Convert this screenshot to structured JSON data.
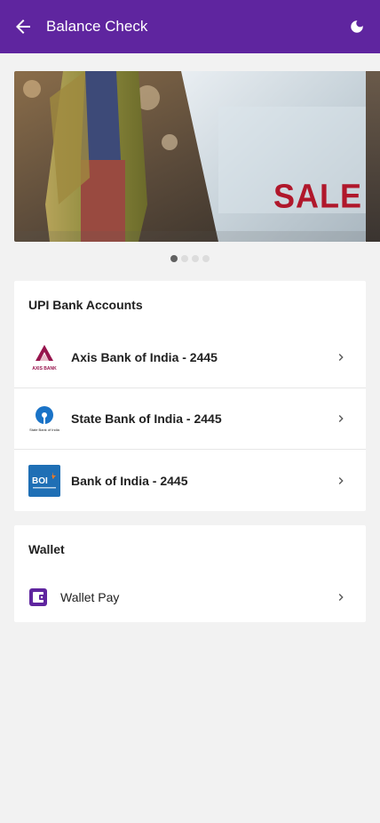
{
  "appbar": {
    "title": "Balance Check",
    "back_icon": "arrow-left-icon",
    "theme_icon": "moon-icon",
    "bg_color": "#5f259f"
  },
  "banner": {
    "sale_text": "SALE",
    "slides_count": 4,
    "active_slide": 1
  },
  "upi": {
    "title": "UPI Bank Accounts",
    "accounts": [
      {
        "label": "Axis Bank of India - 2445",
        "logo": "axis-bank-logo",
        "logo_text": "AXIS BANK"
      },
      {
        "label": "State Bank of India - 2445",
        "logo": "sbi-logo",
        "logo_text": "State Bank of India"
      },
      {
        "label": "Bank of India - 2445",
        "logo": "boi-logo",
        "logo_text": "BOI"
      }
    ]
  },
  "wallet": {
    "title": "Wallet",
    "items": [
      {
        "label": "Wallet Pay",
        "icon": "wallet-icon"
      }
    ]
  }
}
